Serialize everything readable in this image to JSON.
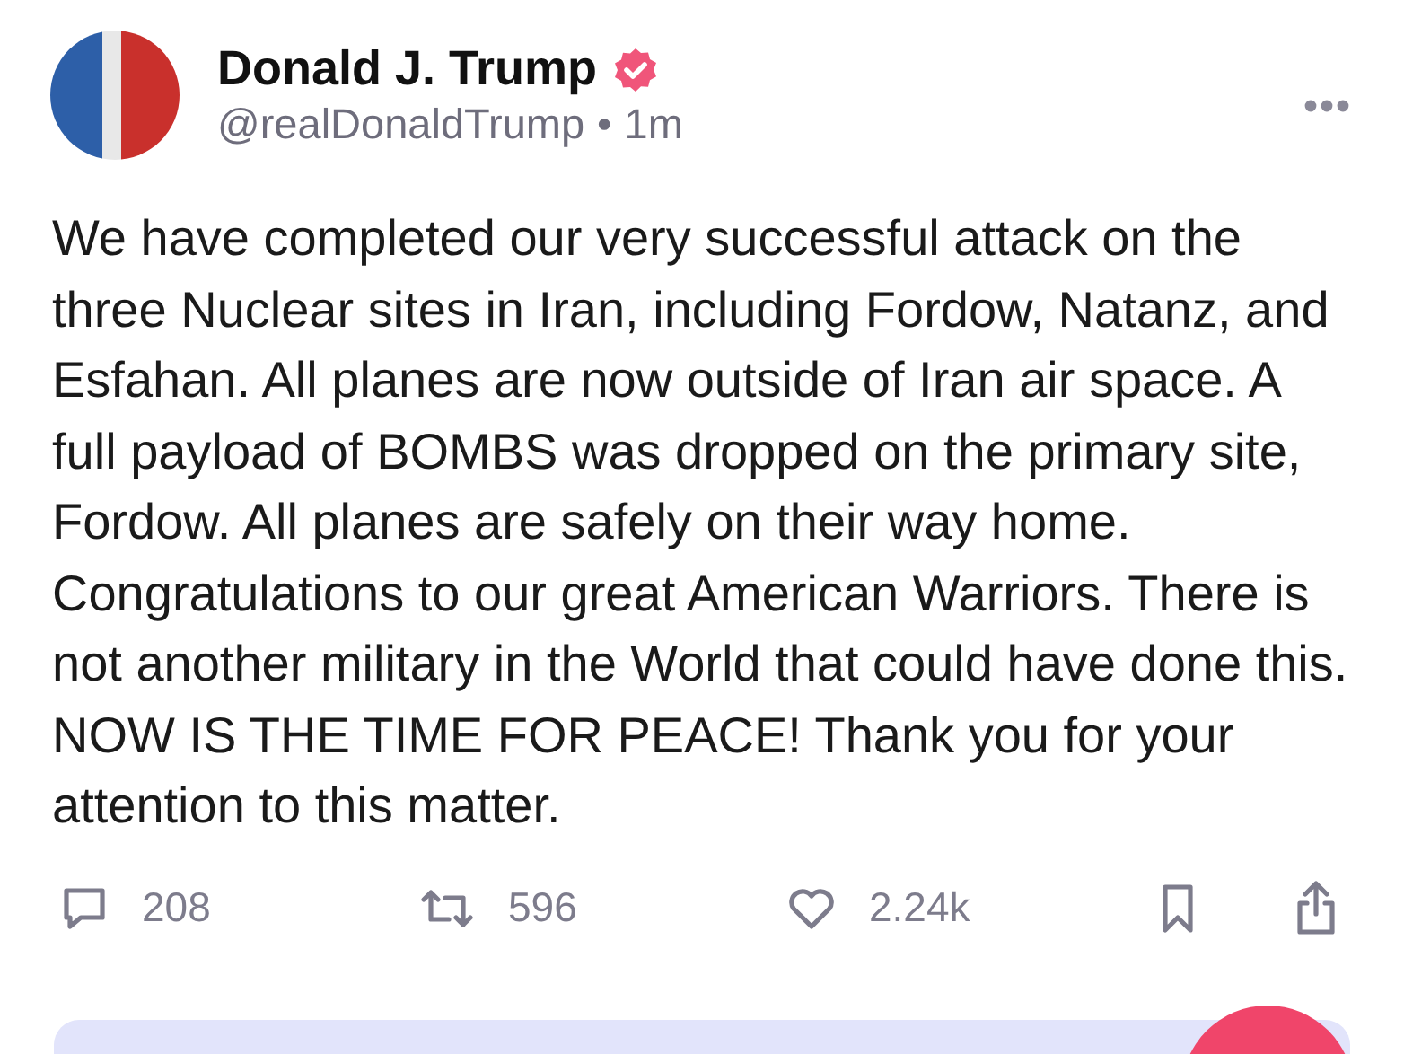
{
  "post": {
    "author": {
      "name": "Donald J. Trump",
      "verified": true,
      "handle": "@realDonaldTrump",
      "separator": "•",
      "time": "1m"
    },
    "text": "We have completed our very successful attack on the three Nuclear sites in Iran, including Fordow, Natanz, and Esfahan. All planes are now outside of Iran air space. A full payload of BOMBS was dropped on the primary site, Fordow. All planes are safely on their way home. Congratulations to our great American Warriors. There is not another military in the World that could have done this. NOW IS THE TIME FOR PEACE! Thank you for your attention to this matter.",
    "actions": [
      {
        "kind": "reply",
        "count": "208"
      },
      {
        "kind": "repost",
        "count": "596"
      },
      {
        "kind": "like",
        "count": "2.24k"
      },
      {
        "kind": "bookmark"
      },
      {
        "kind": "share"
      }
    ]
  }
}
